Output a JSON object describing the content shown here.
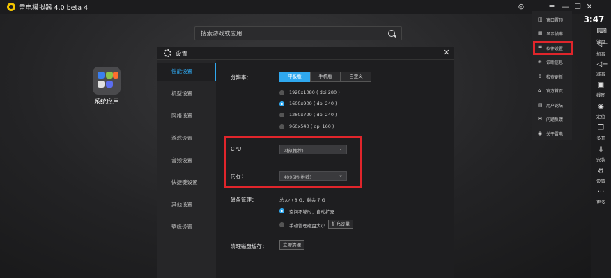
{
  "window": {
    "title": "雷电模拟器 4.0 beta 4",
    "icons": [
      "gamepad-icon",
      "menu-icon",
      "minimize-icon",
      "maximize-icon",
      "close-icon"
    ],
    "icon_glyphs": [
      "⊙",
      "≡",
      "—",
      "☐",
      "✕"
    ]
  },
  "clock": "3:47",
  "search": {
    "placeholder": "搜索游戏或应用"
  },
  "desktop": {
    "app_label": "系统应用"
  },
  "menu": {
    "items": [
      {
        "icon": "◫",
        "label": "窗口置顶"
      },
      {
        "icon": "▦",
        "label": "显示帧率"
      },
      {
        "icon": "☰",
        "label": "软件设置"
      },
      {
        "icon": "⊕",
        "label": "诊断信息"
      },
      {
        "icon": "⇪",
        "label": "检查更新"
      },
      {
        "icon": "⌂",
        "label": "官方首页"
      },
      {
        "icon": "▤",
        "label": "用户论坛"
      },
      {
        "icon": "✉",
        "label": "问题反馈"
      },
      {
        "icon": "◉",
        "label": "关于雷电"
      }
    ],
    "highlighted": "软件设置"
  },
  "sidebar": {
    "items": [
      {
        "icon": "⌨",
        "label": "键盘"
      },
      {
        "icon": "◁+",
        "label": "加音"
      },
      {
        "icon": "◁−",
        "label": "减音"
      },
      {
        "icon": "▣",
        "label": "截图"
      },
      {
        "icon": "◉",
        "label": "定位"
      },
      {
        "icon": "❐",
        "label": "多开"
      },
      {
        "icon": "⇩",
        "label": "安装"
      },
      {
        "icon": "⚙",
        "label": "设置"
      },
      {
        "icon": "···",
        "label": "更多"
      }
    ]
  },
  "dialog": {
    "title": "设置",
    "nav": [
      "性能设置",
      "机型设置",
      "网络设置",
      "游戏设置",
      "音频设置",
      "快捷键设置",
      "其他设置",
      "壁纸设置"
    ],
    "active_nav": "性能设置",
    "resolution": {
      "label": "分辨率：",
      "modes": [
        "平板版",
        "手机版",
        "自定义"
      ],
      "active_mode": "平板版",
      "options": [
        "1920x1080 ( dpi 280 )",
        "1600x900 ( dpi 240 )",
        "1280x720 ( dpi 240 )",
        "960x540 ( dpi 160 )"
      ],
      "selected": "1600x900 ( dpi 240 )"
    },
    "cpu": {
      "label": "CPU:",
      "value": "2核(推荐)",
      "chevron": "⌄"
    },
    "memory": {
      "label": "内存：",
      "value": "4096M(推荐)",
      "chevron": "⌄"
    },
    "disk": {
      "label": "磁盘管理：",
      "summary": "总大小 8 G，剩余 7 G",
      "options": [
        "空间不够时，自动扩充",
        "手动管理磁盘大小"
      ],
      "selected": "空间不够时，自动扩充",
      "expand_button": "扩充容量"
    },
    "cache": {
      "label": "清理磁盘缓存：",
      "button": "立即清理"
    }
  },
  "colors": {
    "accent": "#2fa8ef",
    "highlight": "#e0252b"
  }
}
